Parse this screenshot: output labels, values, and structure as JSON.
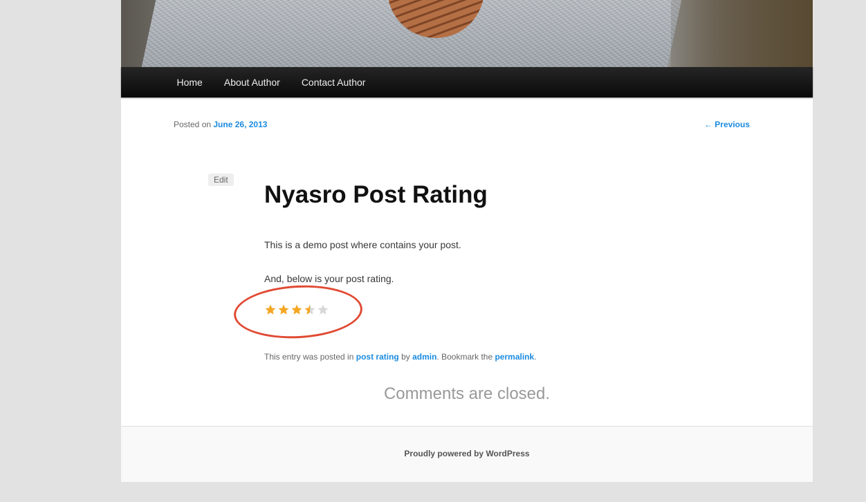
{
  "nav": {
    "items": [
      {
        "label": "Home"
      },
      {
        "label": "About Author"
      },
      {
        "label": "Contact Author"
      }
    ]
  },
  "post": {
    "posted_prefix": "Posted on ",
    "date": "June 26, 2013",
    "previous_label": "← Previous",
    "edit_label": "Edit",
    "title": "Nyasro Post Rating",
    "paragraphs": [
      "This is a demo post where contains your post.",
      "And, below is your post rating."
    ],
    "rating": {
      "value": 3.5,
      "max": 5,
      "filled_color": "#f5a623",
      "empty_color": "#d8d8d8"
    },
    "highlight_color": "#e04a33",
    "meta": {
      "prefix": "This entry was posted in ",
      "category": "post rating",
      "by": " by ",
      "author": "admin",
      "bookmark": ". Bookmark the ",
      "permalink": "permalink",
      "end": "."
    },
    "comments_closed": "Comments are closed."
  },
  "footer": {
    "powered": "Proudly powered by WordPress"
  },
  "colors": {
    "link": "#1b8be0",
    "background": "#e2e2e2",
    "navbar": "#111111"
  }
}
